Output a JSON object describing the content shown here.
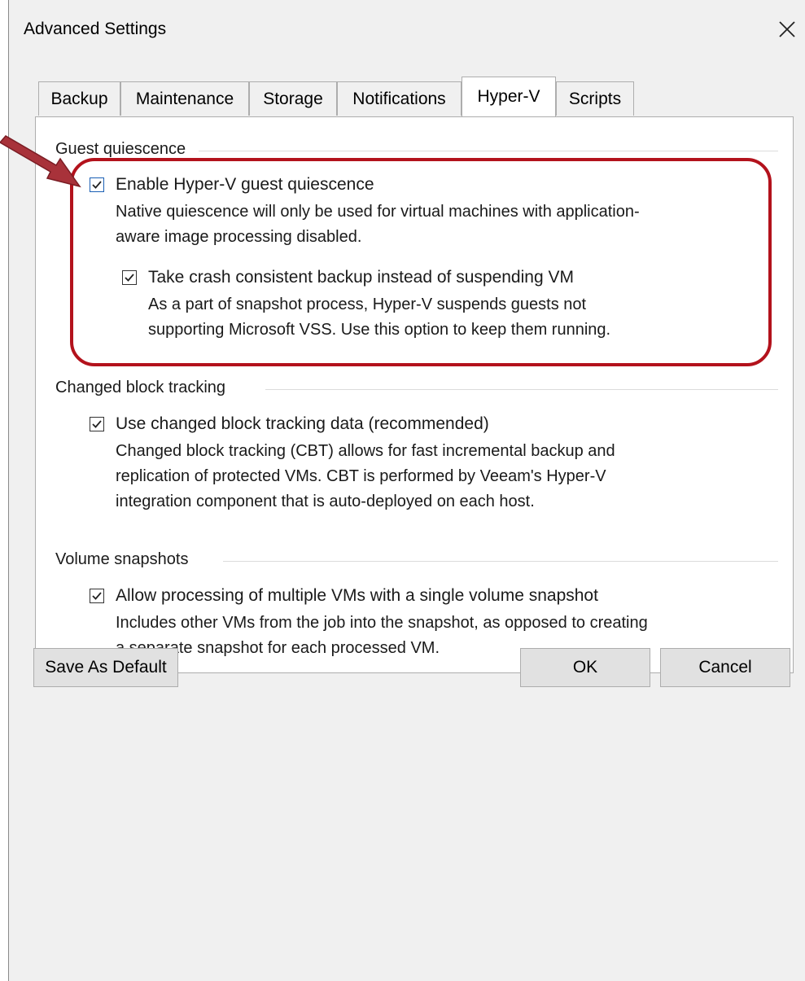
{
  "window": {
    "title": "Advanced Settings"
  },
  "tabs": [
    {
      "label": "Backup"
    },
    {
      "label": "Maintenance"
    },
    {
      "label": "Storage"
    },
    {
      "label": "Notifications"
    },
    {
      "label": "Hyper-V",
      "active": true
    },
    {
      "label": "Scripts"
    }
  ],
  "guest_quiescence": {
    "title": "Guest quiescence",
    "enable": {
      "label": "Enable Hyper-V guest quiescence",
      "checked": true
    },
    "enable_desc": [
      "Native quiescence will only be used for virtual machines with application-",
      "aware image processing disabled."
    ],
    "crash": {
      "label": "Take crash consistent backup instead of suspending VM",
      "checked": true
    },
    "crash_desc": [
      "As a part of snapshot process, Hyper-V suspends guests not",
      "supporting Microsoft VSS. Use this option to keep them running."
    ]
  },
  "cbt": {
    "title": "Changed block tracking",
    "use": {
      "label": "Use changed block tracking data (recommended)",
      "checked": true
    },
    "desc": [
      "Changed block tracking (CBT) allows for fast incremental backup and",
      "replication of protected VMs. CBT is performed by Veeam's Hyper-V",
      "integration component that is auto-deployed on each host."
    ]
  },
  "volume": {
    "title": "Volume snapshots",
    "allow": {
      "label": "Allow processing of multiple VMs with a single volume snapshot",
      "checked": true
    },
    "desc": [
      "Includes other VMs from the job into the snapshot, as opposed to creating",
      "a separate snapshot for each processed VM."
    ]
  },
  "buttons": {
    "save_default": "Save As Default",
    "ok": "OK",
    "cancel": "Cancel"
  },
  "colors": {
    "highlight": "#b3121c",
    "arrow": "#a8323a"
  }
}
